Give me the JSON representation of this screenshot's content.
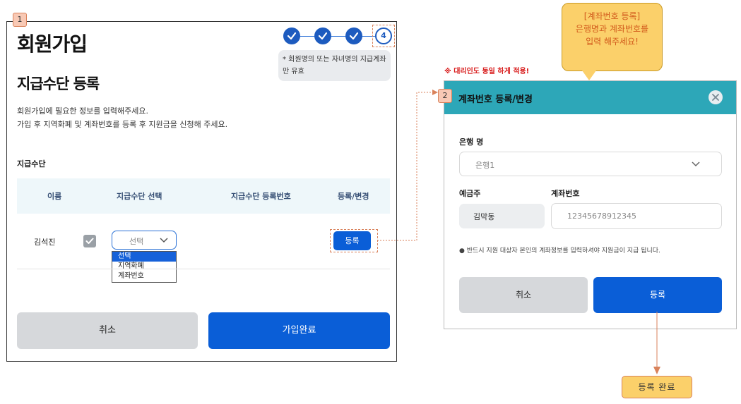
{
  "main": {
    "step_badge": "1",
    "page_title": "회원가입",
    "section_title": "지급수단 등록",
    "desc_line1": "회원가입에 필요한 정보를 입력해주세요.",
    "desc_line2": "가입 후 지역화폐 및 계좌번호를 등록 후 지원금을 신청해 주세요.",
    "current_step": "4",
    "note_line1": "* 회원명의 또는 자녀명의 지급계좌",
    "note_line2": "만 유효",
    "payment_label": "지급수단",
    "columns": [
      "이름",
      "지급수단 선택",
      "지급수단 등록번호",
      "등록/변경"
    ],
    "row": {
      "name": "김석진",
      "select_value": "선택",
      "options": [
        "선택",
        "지역화폐",
        "계좌번호"
      ],
      "register_label": "등록"
    },
    "cancel_label": "취소",
    "complete_label": "가입완료"
  },
  "callout": {
    "line1": "[계좌번호 등록]",
    "line2": "은행명과 계좌번호를",
    "line3": "입력 해주세요!"
  },
  "warning_note": "※ 대리인도 동일 하게 적용!",
  "modal": {
    "step_badge": "2",
    "title": "계좌번호 등록/변경",
    "bank_label": "은행 명",
    "bank_value": "은행1",
    "holder_label": "예금주",
    "holder_value": "김막동",
    "account_label": "계좌번호",
    "account_value": "12345678912345",
    "notice": "● 반드시 지원 대상자 본인의 계좌정보를 입력하셔야 지원금이 지급 됩니다.",
    "cancel_label": "취소",
    "register_label": "등록"
  },
  "done_label": "등록 완료",
  "colors": {
    "primary": "#0a5ed7",
    "modal_header": "#2da7b8",
    "callout": "#fbd06a",
    "annotation": "#d9825b",
    "warning": "#d81b1b"
  }
}
